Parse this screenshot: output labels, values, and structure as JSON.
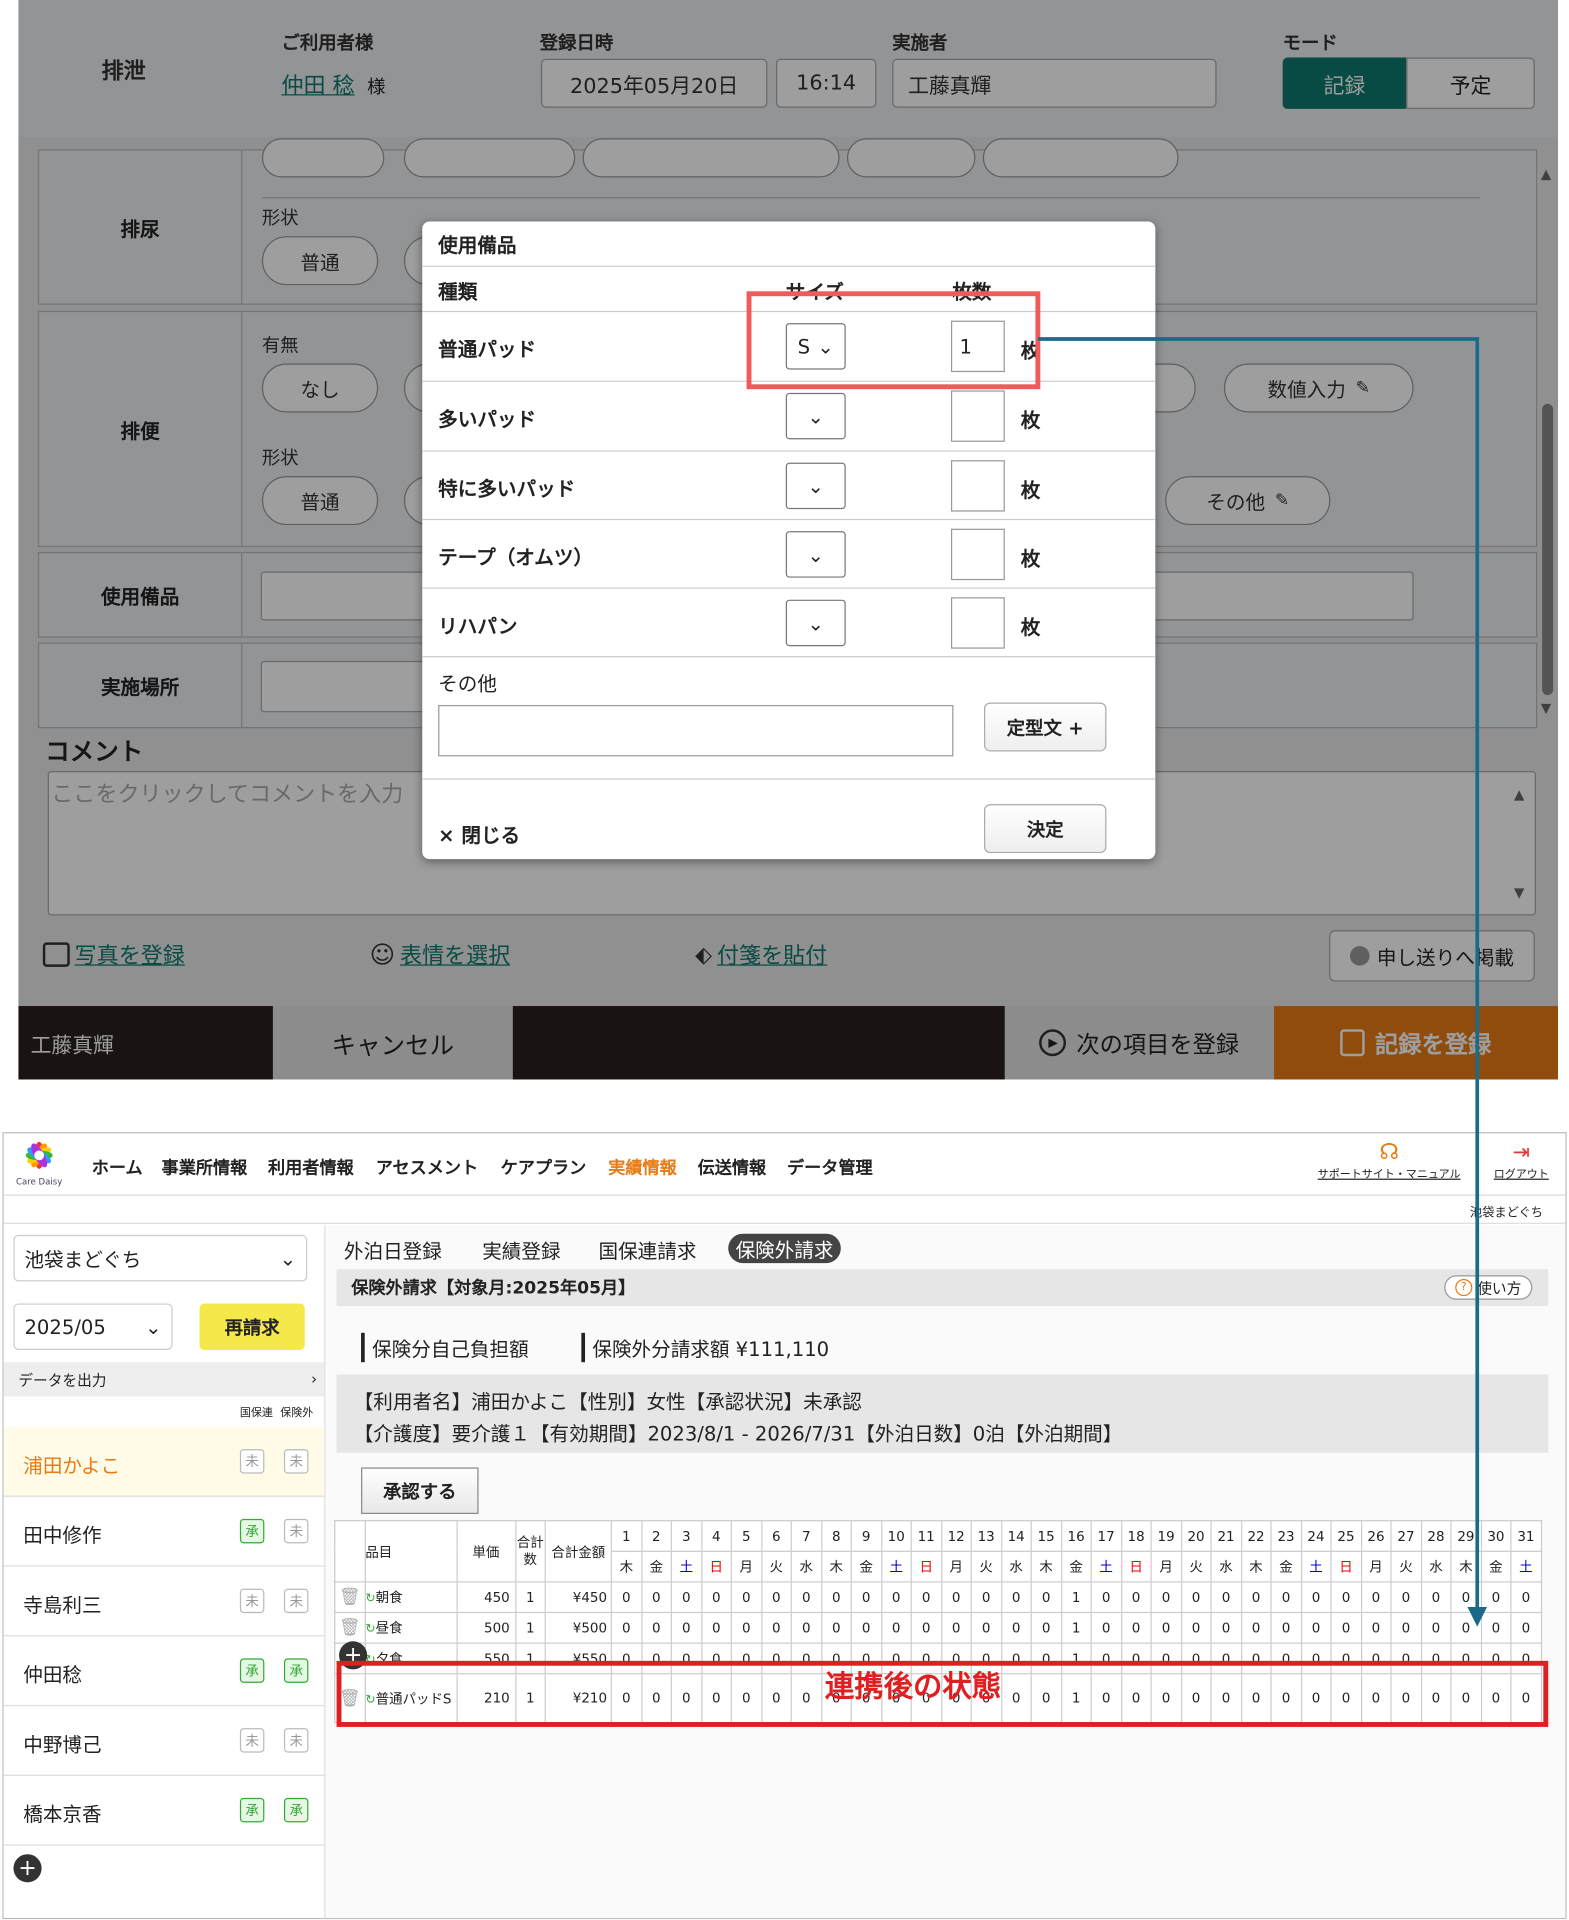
{
  "header": {
    "title": "排泄",
    "user_label": "ご利用者様",
    "user_name": "仲田 稔",
    "user_suffix": "様",
    "date_label": "登録日時",
    "date": "2025年05月20日",
    "time": "16:14",
    "staff_label": "実施者",
    "staff": "工藤真輝",
    "mode_label": "モード",
    "mode_record": "記録",
    "mode_plan": "予定"
  },
  "form": {
    "urine_label": "排尿",
    "urine_shape_label": "形状",
    "urine_shape_option": "普通",
    "stool_label": "排便",
    "stool_presence_label": "有無",
    "stool_none": "なし",
    "stool_numeric": "数値入力",
    "stool_shape_label": "形状",
    "stool_shape_option": "普通",
    "stool_other": "その他",
    "supplies_label": "使用備品",
    "place_label": "実施場所",
    "comment_label": "コメント",
    "comment_placeholder": "ここをクリックしてコメントを入力",
    "photo_link": "写真を登録",
    "face_link": "表情を選択",
    "tag_link": "付箋を貼付",
    "handover_button": "申し送りへ掲載"
  },
  "footer": {
    "staff": "工藤真輝",
    "cancel": "キャンセル",
    "next": "次の項目を登録",
    "save": "記録を登録"
  },
  "modal": {
    "title": "使用備品",
    "col_type": "種類",
    "col_size": "サイズ",
    "col_count": "枚数",
    "unit": "枚",
    "rows": [
      {
        "name": "普通パッド",
        "size": "S",
        "count": "1"
      },
      {
        "name": "多いパッド",
        "size": "",
        "count": ""
      },
      {
        "name": "特に多いパッド",
        "size": "",
        "count": ""
      },
      {
        "name": "テープ（オムツ）",
        "size": "",
        "count": ""
      },
      {
        "name": "リハパン",
        "size": "",
        "count": ""
      }
    ],
    "other_label": "その他",
    "template_button": "定型文 +",
    "close": "× 閉じる",
    "confirm": "決定"
  },
  "app": {
    "logo": "Care Daisy",
    "nav": [
      "ホーム",
      "事業所情報",
      "利用者情報",
      "アセスメント",
      "ケアプラン",
      "実績情報",
      "伝送情報",
      "データ管理"
    ],
    "support": "サポートサイト・マニュアル",
    "logout": "ログアウト",
    "office": "池袋まどぐち",
    "side_office": "池袋まどぐち",
    "side_month": "2025/05",
    "rebill": "再請求",
    "export": "データを出力",
    "col_a": "国保連",
    "col_b": "保険外",
    "users": [
      {
        "name": "浦田かよこ",
        "a": "未",
        "b": "未"
      },
      {
        "name": "田中修作",
        "a": "承",
        "b": "未"
      },
      {
        "name": "寺島利三",
        "a": "未",
        "b": "未"
      },
      {
        "name": "仲田稔",
        "a": "承",
        "b": "承"
      },
      {
        "name": "中野博己",
        "a": "未",
        "b": "未"
      },
      {
        "name": "橋本京香",
        "a": "承",
        "b": "承"
      }
    ],
    "tabs": [
      "外泊日登録",
      "実績登録",
      "国保連請求",
      "保険外請求"
    ],
    "section_title": "保険外請求【対象月:2025年05月】",
    "help": "使い方",
    "self_pay": "保険分自己負担額",
    "outside_total": "保険外分請求額 ¥111,110",
    "info1": "【利用者名】浦田かよこ【性別】女性【承認状況】未承認",
    "info2": "【介護度】要介護１【有効期間】2023/8/1 - 2026/7/31【外泊日数】0泊【外泊期間】",
    "approve": "承認する",
    "table_headers": {
      "item": "品目",
      "price": "単価",
      "qty": "合計数",
      "total": "合計金額"
    },
    "days": [
      "1",
      "2",
      "3",
      "4",
      "5",
      "6",
      "7",
      "8",
      "9",
      "10",
      "11",
      "12",
      "13",
      "14",
      "15",
      "16",
      "17",
      "18",
      "19",
      "20",
      "21",
      "22",
      "23",
      "24",
      "25",
      "26",
      "27",
      "28",
      "29",
      "30",
      "31"
    ],
    "weekdays": [
      "木",
      "金",
      "土",
      "日",
      "月",
      "火",
      "水",
      "木",
      "金",
      "土",
      "日",
      "月",
      "火",
      "水",
      "木",
      "金",
      "土",
      "日",
      "月",
      "火",
      "水",
      "木",
      "金",
      "土",
      "日",
      "月",
      "火",
      "水",
      "木",
      "金",
      "土"
    ],
    "rows": [
      {
        "item": "朝食",
        "price": "450",
        "qty": "1",
        "total": "¥450",
        "day16": "1"
      },
      {
        "item": "昼食",
        "price": "500",
        "qty": "1",
        "total": "¥500",
        "day16": "1"
      },
      {
        "item": "夕食",
        "price": "550",
        "qty": "1",
        "total": "¥550",
        "day16": "1"
      },
      {
        "item": "普通パッドS",
        "price": "210",
        "qty": "1",
        "total": "¥210",
        "day16": "1"
      }
    ],
    "caption": "連携後の状態"
  },
  "colors": {
    "teal": "#0e7a6e",
    "orange": "#e87b14",
    "highlight": "#f05a5a",
    "red_box": "#e02020",
    "arrow": "#1a6a8a"
  }
}
